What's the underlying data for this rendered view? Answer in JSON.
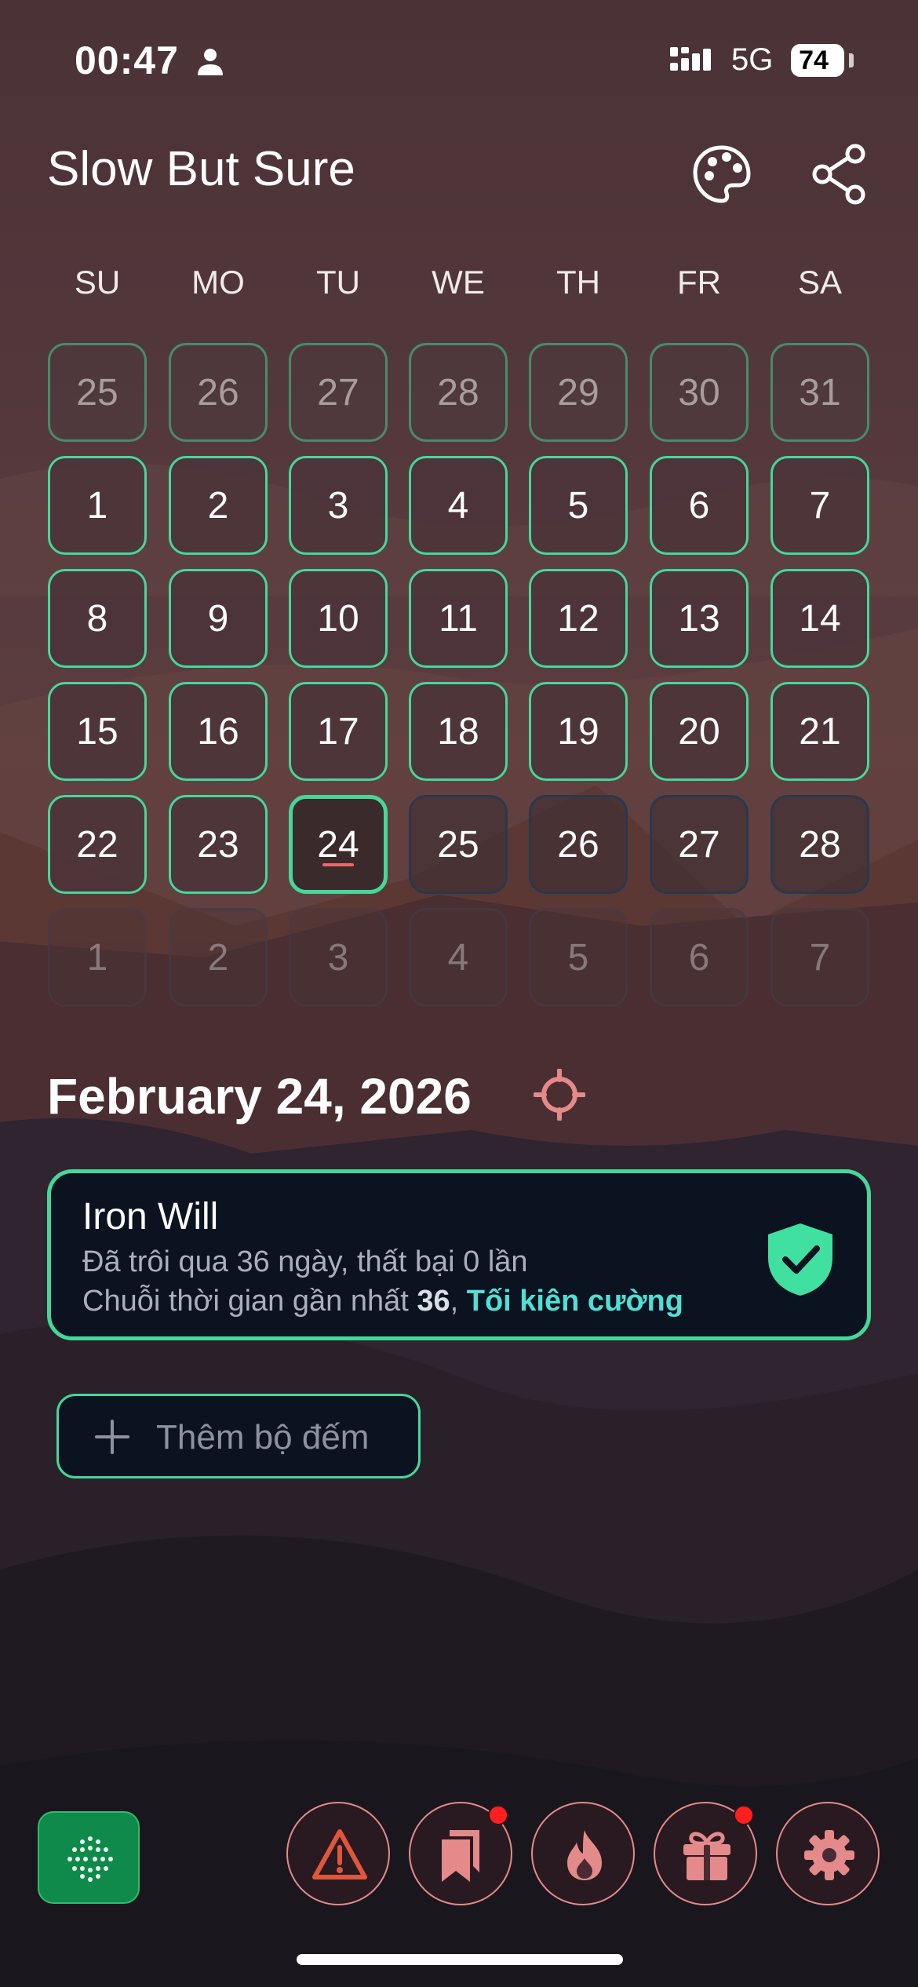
{
  "status_bar": {
    "time": "00:47",
    "network": "5G",
    "battery": "74"
  },
  "header": {
    "title": "Slow But Sure"
  },
  "weekdays": [
    "SU",
    "MO",
    "TU",
    "WE",
    "TH",
    "FR",
    "SA"
  ],
  "calendar": {
    "rows": [
      [
        "25",
        "26",
        "27",
        "28",
        "29",
        "30",
        "31"
      ],
      [
        "1",
        "2",
        "3",
        "4",
        "5",
        "6",
        "7"
      ],
      [
        "8",
        "9",
        "10",
        "11",
        "12",
        "13",
        "14"
      ],
      [
        "15",
        "16",
        "17",
        "18",
        "19",
        "20",
        "21"
      ],
      [
        "22",
        "23",
        "24",
        "25",
        "26",
        "27",
        "28"
      ],
      [
        "1",
        "2",
        "3",
        "4",
        "5",
        "6",
        "7"
      ]
    ],
    "today": "24"
  },
  "selected_date": "February 24, 2026",
  "counter": {
    "name": "Iron Will",
    "line1": "Đã trôi qua 36 ngày, thất bại 0 lần",
    "line2_prefix": "Chuỗi thời gian gần nhất ",
    "line2_number": "36",
    "line2_sep": ", ",
    "line2_rank": "Tối kiên cường"
  },
  "add_counter": {
    "label": "Thêm bộ đếm"
  },
  "bottom_bar": {
    "buttons": [
      {
        "icon": "warning-icon"
      },
      {
        "icon": "bookmarks-icon",
        "badge": true
      },
      {
        "icon": "flame-icon"
      },
      {
        "icon": "gift-icon",
        "badge": true
      },
      {
        "icon": "gear-icon"
      }
    ]
  },
  "colors": {
    "accent": "#45d79a",
    "icon_pink": "#e48a8a",
    "card_bg": "#0b1220",
    "rank_text": "#4fe0d3"
  }
}
